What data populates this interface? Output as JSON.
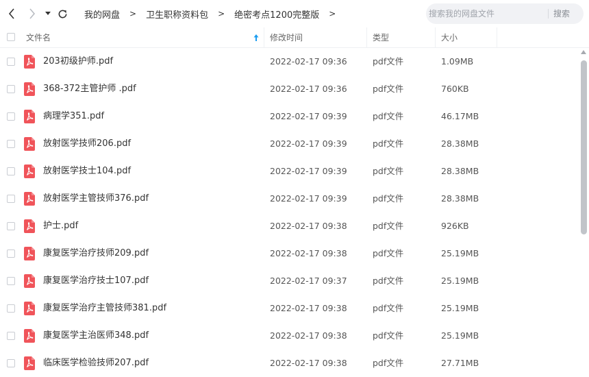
{
  "nav": {
    "back_icon": "chevron-left-icon",
    "forward_icon": "chevron-right-icon",
    "history_icon": "caret-down-icon",
    "refresh_icon": "refresh-icon"
  },
  "breadcrumb": {
    "items": [
      "我的网盘",
      "卫生职称资料包",
      "绝密考点1200完整版"
    ],
    "separator": ">"
  },
  "search": {
    "placeholder": "搜索我的网盘文件",
    "button_label": "搜索"
  },
  "table": {
    "columns": {
      "name": "文件名",
      "modified": "修改时间",
      "type": "类型",
      "size": "大小"
    },
    "sort_indicator": "arrow-up-icon",
    "rows": [
      {
        "name": "203初级护师.pdf",
        "modified": "2022-02-17 09:36",
        "type": "pdf文件",
        "size": "1.09MB"
      },
      {
        "name": "368-372主管护师 .pdf",
        "modified": "2022-02-17 09:36",
        "type": "pdf文件",
        "size": "760KB"
      },
      {
        "name": "病理学351.pdf",
        "modified": "2022-02-17 09:39",
        "type": "pdf文件",
        "size": "46.17MB"
      },
      {
        "name": "放射医学技师206.pdf",
        "modified": "2022-02-17 09:39",
        "type": "pdf文件",
        "size": "28.38MB"
      },
      {
        "name": "放射医学技士104.pdf",
        "modified": "2022-02-17 09:39",
        "type": "pdf文件",
        "size": "28.38MB"
      },
      {
        "name": "放射医学主管技师376.pdf",
        "modified": "2022-02-17 09:39",
        "type": "pdf文件",
        "size": "28.38MB"
      },
      {
        "name": "护士.pdf",
        "modified": "2022-02-17 09:38",
        "type": "pdf文件",
        "size": "926KB"
      },
      {
        "name": "康复医学治疗技师209.pdf",
        "modified": "2022-02-17 09:38",
        "type": "pdf文件",
        "size": "25.19MB"
      },
      {
        "name": "康复医学治疗技士107.pdf",
        "modified": "2022-02-17 09:37",
        "type": "pdf文件",
        "size": "25.19MB"
      },
      {
        "name": "康复医学治疗主管技师381.pdf",
        "modified": "2022-02-17 09:38",
        "type": "pdf文件",
        "size": "25.19MB"
      },
      {
        "name": "康复医学主治医师348.pdf",
        "modified": "2022-02-17 09:38",
        "type": "pdf文件",
        "size": "25.19MB"
      },
      {
        "name": "临床医学检验技师207.pdf",
        "modified": "2022-02-17 09:38",
        "type": "pdf文件",
        "size": "27.71MB"
      }
    ]
  },
  "colors": {
    "pdf_icon": "#f0545a",
    "sort_arrow": "#1a9cf0",
    "search_bg": "#f1f2f5",
    "scroll_thumb": "#c1c4c9"
  }
}
